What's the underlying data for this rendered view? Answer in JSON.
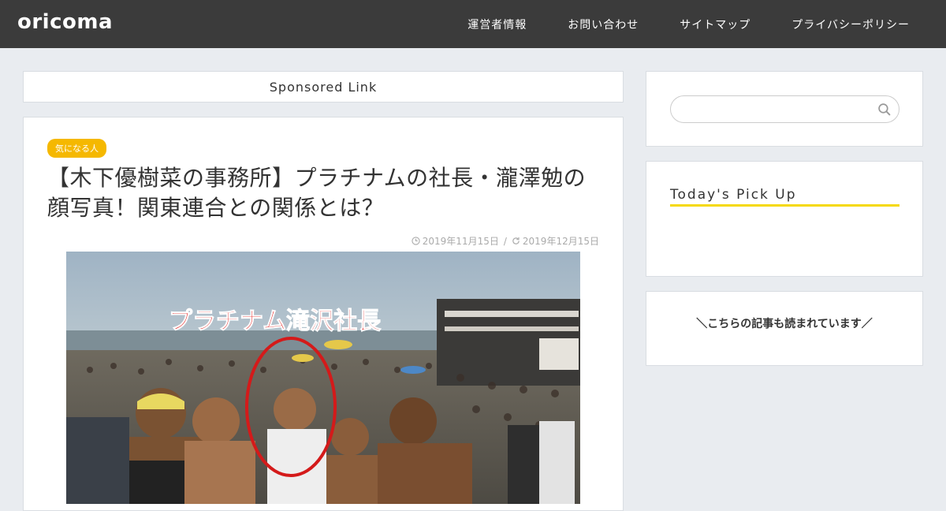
{
  "header": {
    "logo": "oricoma",
    "nav": [
      "運営者情報",
      "お問い合わせ",
      "サイトマップ",
      "プライバシーポリシー"
    ]
  },
  "sponsored": {
    "label": "Sponsored Link"
  },
  "article": {
    "category": "気になる人",
    "title": "【木下優樹菜の事務所】プラチナムの社長・瀧澤勉の顔写真！関東連合との関係とは？",
    "published": "2019年11月15日",
    "updated": "2019年12月15日",
    "date_separator": "/",
    "image_caption": "プラチナム滝沢社長"
  },
  "sidebar": {
    "search": {
      "placeholder": ""
    },
    "pick_title": "Today's Pick Up",
    "read_title": "＼こちらの記事も読まれています／"
  },
  "colors": {
    "header_bg": "#3b3b3b",
    "page_bg": "#e9ecf0",
    "accent_yellow": "#f5b800",
    "underline_yellow": "#f5d90a",
    "caption_red": "#e01818"
  }
}
